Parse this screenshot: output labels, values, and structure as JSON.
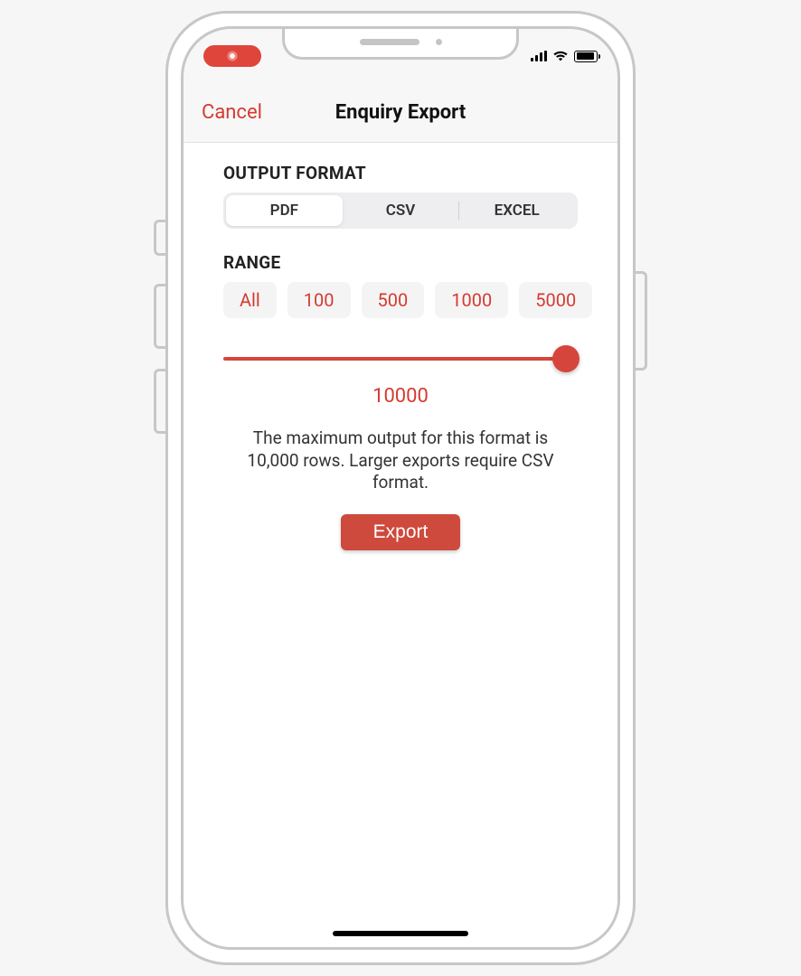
{
  "nav": {
    "cancel": "Cancel",
    "title": "Enquiry Export"
  },
  "sections": {
    "output_format_label": "OUTPUT FORMAT",
    "range_label": "RANGE"
  },
  "formats": {
    "pdf": "PDF",
    "csv": "CSV",
    "excel": "EXCEL",
    "selected": "PDF"
  },
  "range_presets": {
    "all": "All",
    "p100": "100",
    "p500": "500",
    "p1000": "1000",
    "p5000": "5000"
  },
  "slider": {
    "value": "10000",
    "percent": 100
  },
  "info": "The maximum output for this format is 10,000 rows. Larger exports require CSV format.",
  "export_button": "Export"
}
